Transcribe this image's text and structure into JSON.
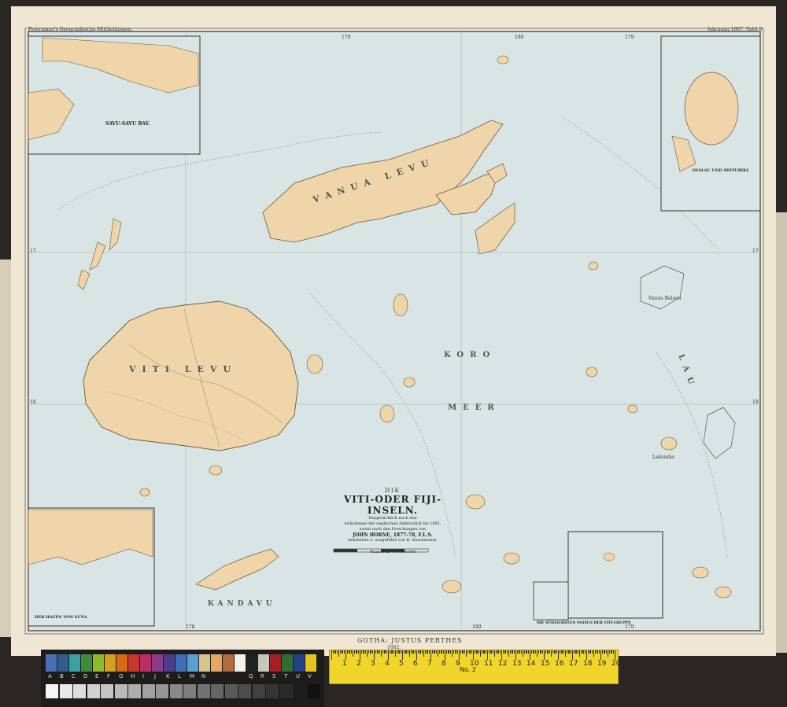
{
  "header": {
    "left": "Petermann's Geographische Mittheilungen.",
    "right": "Jahrgang 1887, Tafel 8."
  },
  "map": {
    "title_prefix": "DIE",
    "title": "VITI-ODER FIJI-INSELN.",
    "subtitle_lines": [
      "Hauptsächlich nach den",
      "Aufnahmen der englischen Admiralität bis 1881,",
      "sowie nach den Forschungen von"
    ],
    "author": "JOHN HORNE, 1877-78, F.L.S.",
    "credit": "bearbeitet u. ausgeführt von B. Hassenstein.",
    "scale": "Maassstab 1:1.500.000"
  },
  "places": {
    "vanua_levu": "VANUA LEVU",
    "viti_levu": "VITI LEVU",
    "koro": "KORO",
    "meer": "MEER",
    "lau": "LAU",
    "kandavu": "KANDAVU",
    "vanua_balavu": "Vanua Balavu",
    "lakemba": "Lakemba"
  },
  "insets": {
    "savu": "SAVU-SAVU BAY.",
    "ovalau": "OVALAU UND MOTURIKI.",
    "suva": "DER HAFEN VON SUVA.",
    "south": "DIE SÜDLICHSTEN INSELN DER VITI-GRUPPE"
  },
  "coords": {
    "top": [
      "179",
      "180",
      "179"
    ],
    "bottom": [
      "178",
      "180",
      "179"
    ],
    "left": [
      "17",
      "18"
    ],
    "right": [
      "17",
      "18"
    ]
  },
  "publisher": "GOTHA: JUSTUS PERTHES",
  "year": "1882.",
  "ruler": {
    "numbers": [
      "1",
      "2",
      "3",
      "4",
      "5",
      "6",
      "7",
      "8",
      "9",
      "10",
      "11",
      "12",
      "13",
      "14",
      "15",
      "16",
      "17",
      "18",
      "19",
      "20"
    ],
    "brand": "No. 2"
  },
  "color_card": {
    "letters": [
      "A",
      "B",
      "C",
      "D",
      "E",
      "F",
      "G",
      "H",
      "I",
      "J",
      "K",
      "L",
      "M",
      "N",
      "",
      "",
      "",
      "Q",
      "R",
      "S",
      "T",
      "U",
      "V"
    ],
    "swatches": [
      "#4a6fb5",
      "#2d5e8c",
      "#3aa0a0",
      "#3f8b3a",
      "#8dbb2e",
      "#d6a01e",
      "#d86a1c",
      "#c43a2a",
      "#b92f63",
      "#8a3b8a",
      "#4b3c8c",
      "#3d6fb8",
      "#58a1cf",
      "#d7c38e",
      "#e2a864",
      "#b46c3e",
      "#f3f0e8",
      "#222222",
      "#c8c6c1",
      "#a21f26",
      "#2c6e34",
      "#263f8a",
      "#e4c320"
    ]
  },
  "colors": {
    "sea": "#d8e5e4",
    "land": "#efd5a9",
    "border": "#333333"
  }
}
